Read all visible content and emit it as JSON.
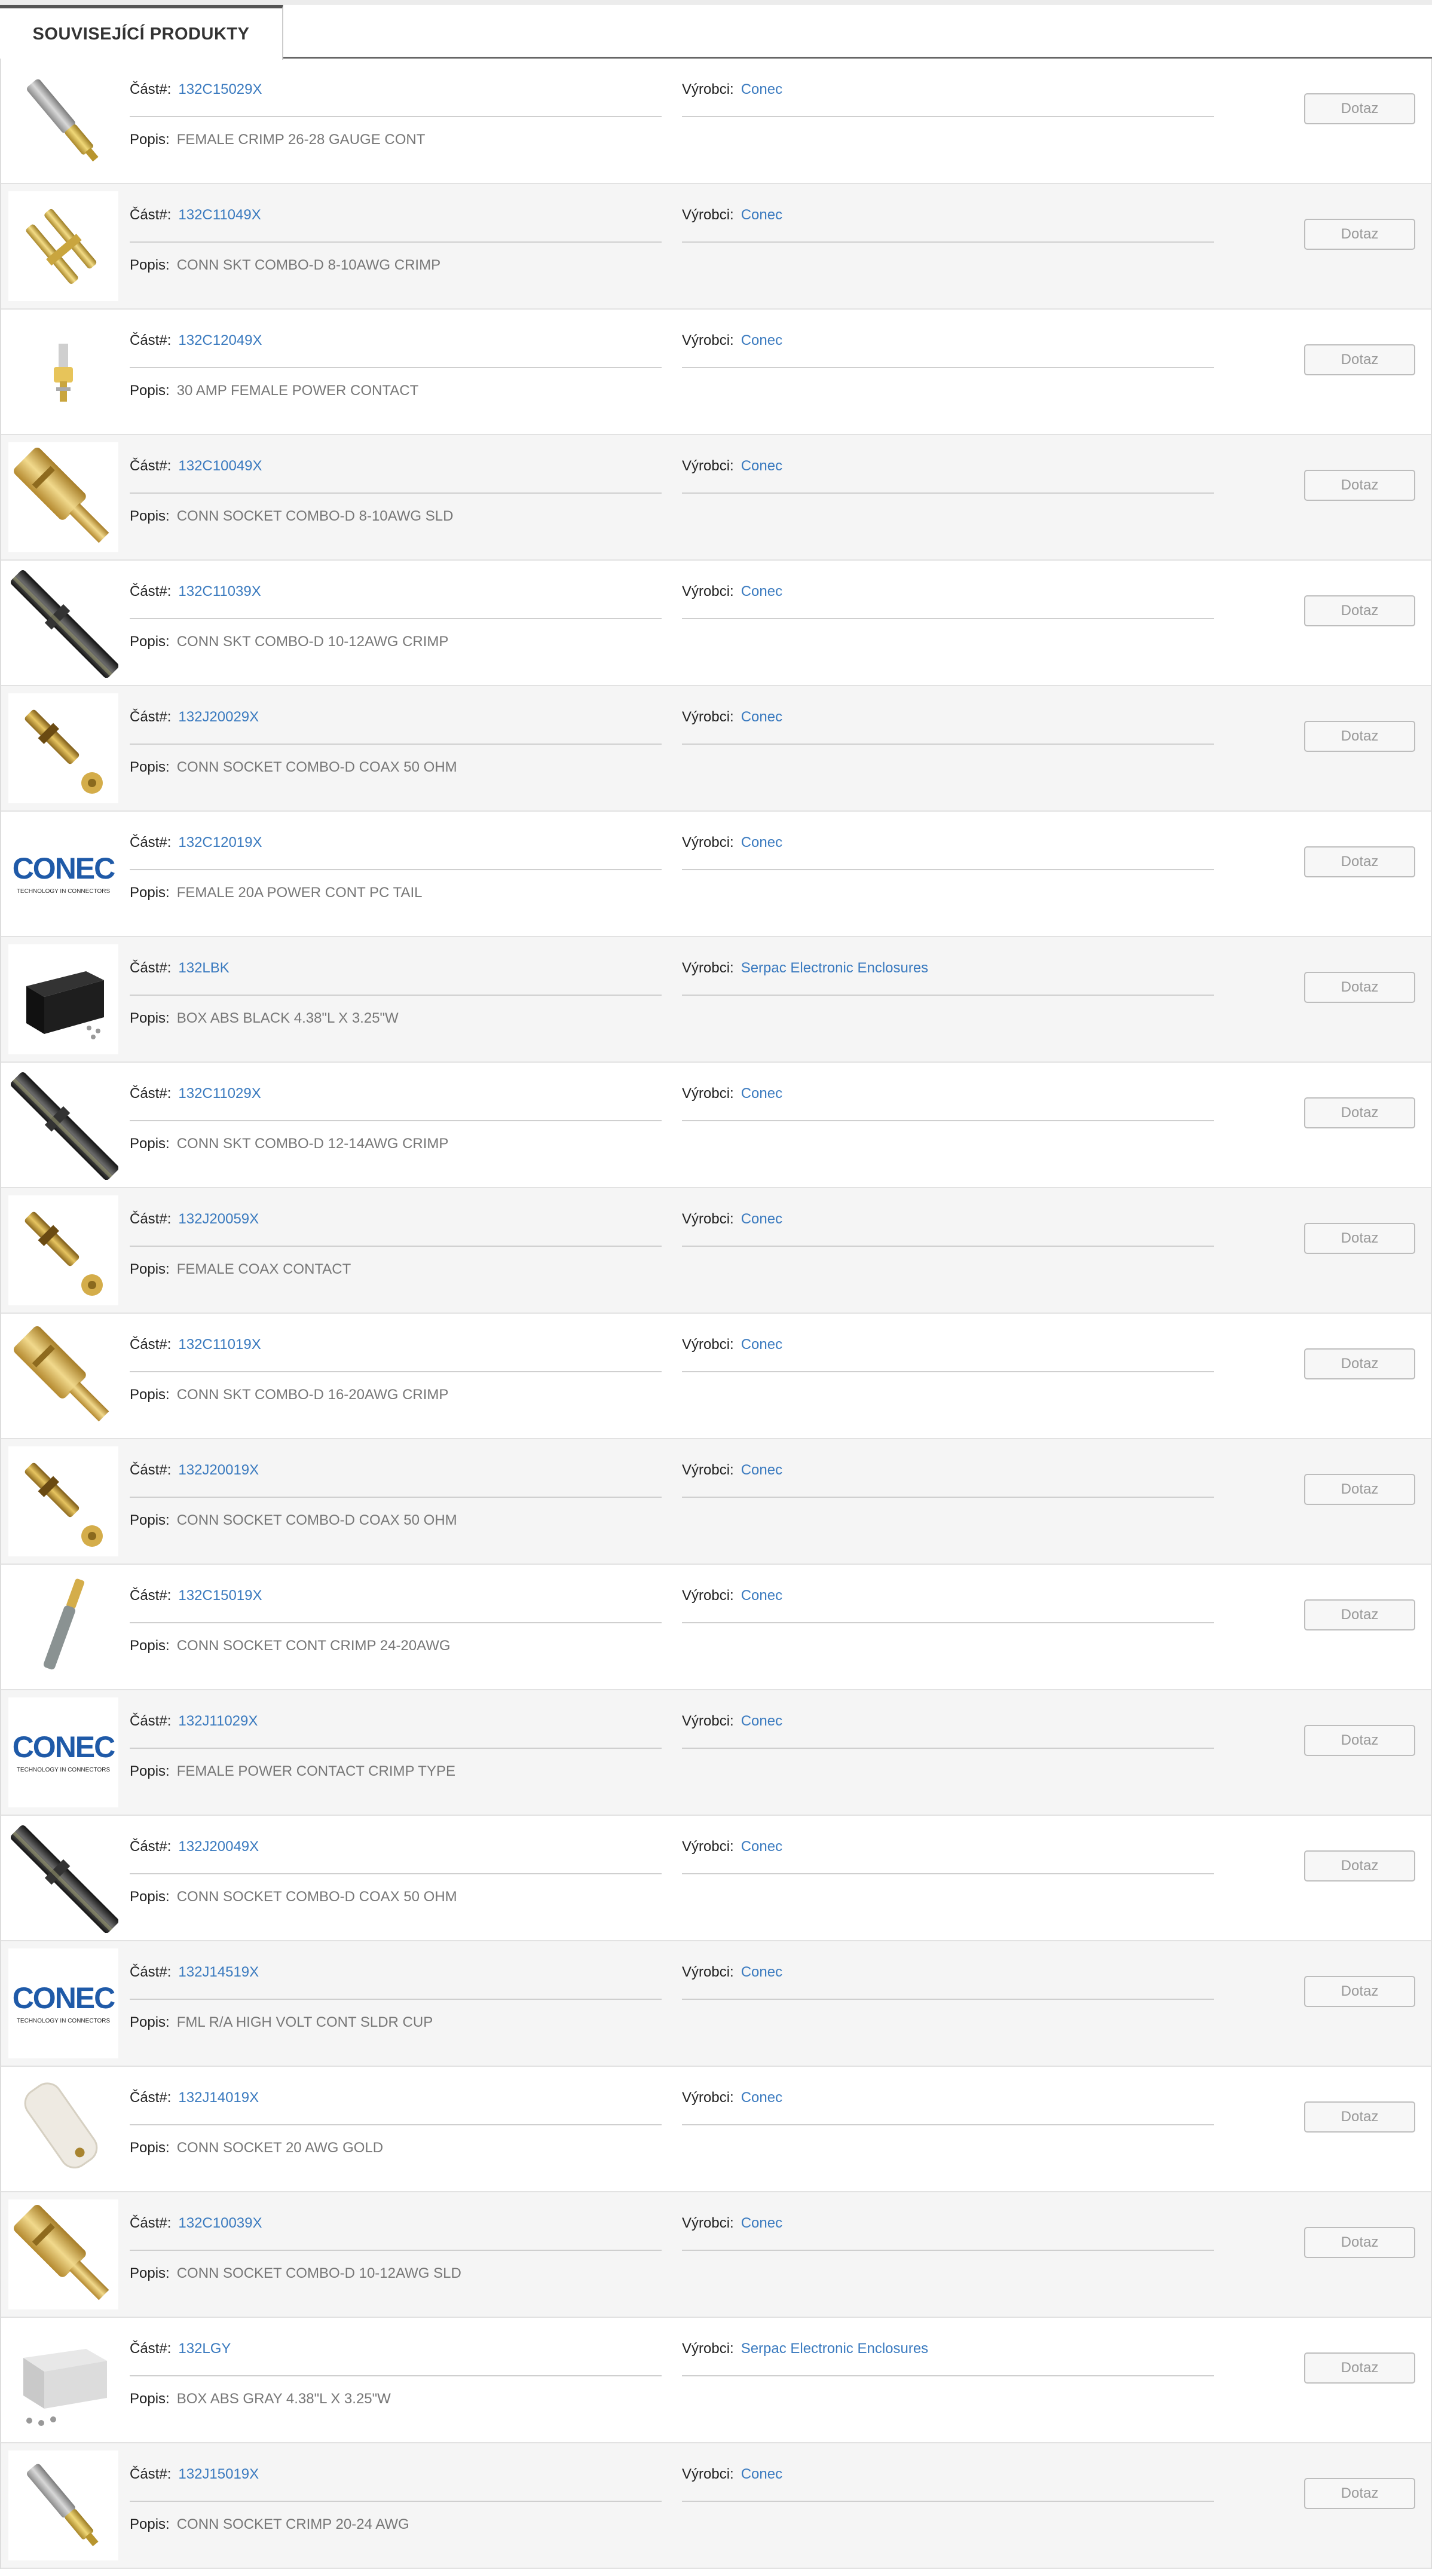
{
  "tab": {
    "label": "SOUVISEJÍCÍ PRODUKTY"
  },
  "labels": {
    "part": "Část#:",
    "manufacturer": "Výrobci:",
    "description": "Popis:",
    "inquiry": "Dotaz"
  },
  "colors": {
    "link": "#3a7abf",
    "row_alt": "#f5f5f5"
  },
  "products": [
    {
      "part": "132C15029X",
      "manufacturer": "Conec",
      "description": "FEMALE CRIMP 26-28 GAUGE CONT",
      "image": "pin-silver-gold"
    },
    {
      "part": "132C11049X",
      "manufacturer": "Conec",
      "description": "CONN SKT COMBO-D 8-10AWG CRIMP",
      "image": "gold-pins"
    },
    {
      "part": "132C12049X",
      "manufacturer": "Conec",
      "description": "30 AMP FEMALE POWER CONTACT",
      "image": "small-contact"
    },
    {
      "part": "132C10049X",
      "manufacturer": "Conec",
      "description": "CONN SOCKET COMBO-D 8-10AWG SLD",
      "image": "gold-socket"
    },
    {
      "part": "132C11039X",
      "manufacturer": "Conec",
      "description": "CONN SKT COMBO-D 10-12AWG CRIMP",
      "image": "black-socket"
    },
    {
      "part": "132J20029X",
      "manufacturer": "Conec",
      "description": "CONN SOCKET COMBO-D COAX 50 OHM",
      "image": "coax-gold"
    },
    {
      "part": "132C12019X",
      "manufacturer": "Conec",
      "description": "FEMALE 20A POWER CONT PC TAIL",
      "image": "conec-logo"
    },
    {
      "part": "132LBK",
      "manufacturer": "Serpac Electronic Enclosures",
      "description": "BOX ABS BLACK 4.38\"L X 3.25\"W",
      "image": "black-box"
    },
    {
      "part": "132C11029X",
      "manufacturer": "Conec",
      "description": "CONN SKT COMBO-D 12-14AWG CRIMP",
      "image": "black-socket"
    },
    {
      "part": "132J20059X",
      "manufacturer": "Conec",
      "description": "FEMALE COAX CONTACT",
      "image": "coax-gold"
    },
    {
      "part": "132C11019X",
      "manufacturer": "Conec",
      "description": "CONN SKT COMBO-D 16-20AWG CRIMP",
      "image": "gold-socket"
    },
    {
      "part": "132J20019X",
      "manufacturer": "Conec",
      "description": "CONN SOCKET COMBO-D COAX 50 OHM",
      "image": "coax-gold"
    },
    {
      "part": "132C15019X",
      "manufacturer": "Conec",
      "description": "CONN SOCKET CONT CRIMP 24-20AWG",
      "image": "thin-pin"
    },
    {
      "part": "132J11029X",
      "manufacturer": "Conec",
      "description": "FEMALE POWER CONTACT CRIMP TYPE",
      "image": "conec-logo"
    },
    {
      "part": "132J20049X",
      "manufacturer": "Conec",
      "description": "CONN SOCKET COMBO-D COAX 50 OHM",
      "image": "black-socket"
    },
    {
      "part": "132J14519X",
      "manufacturer": "Conec",
      "description": "FML R/A HIGH VOLT CONT SLDR CUP",
      "image": "conec-logo"
    },
    {
      "part": "132J14019X",
      "manufacturer": "Conec",
      "description": "CONN SOCKET 20 AWG GOLD",
      "image": "white-insulator"
    },
    {
      "part": "132C10039X",
      "manufacturer": "Conec",
      "description": "CONN SOCKET COMBO-D 10-12AWG SLD",
      "image": "gold-socket"
    },
    {
      "part": "132LGY",
      "manufacturer": "Serpac Electronic Enclosures",
      "description": "BOX ABS GRAY 4.38\"L X 3.25\"W",
      "image": "gray-box"
    },
    {
      "part": "132J15019X",
      "manufacturer": "Conec",
      "description": "CONN SOCKET CRIMP 20-24 AWG",
      "image": "pin-silver-gold"
    }
  ]
}
